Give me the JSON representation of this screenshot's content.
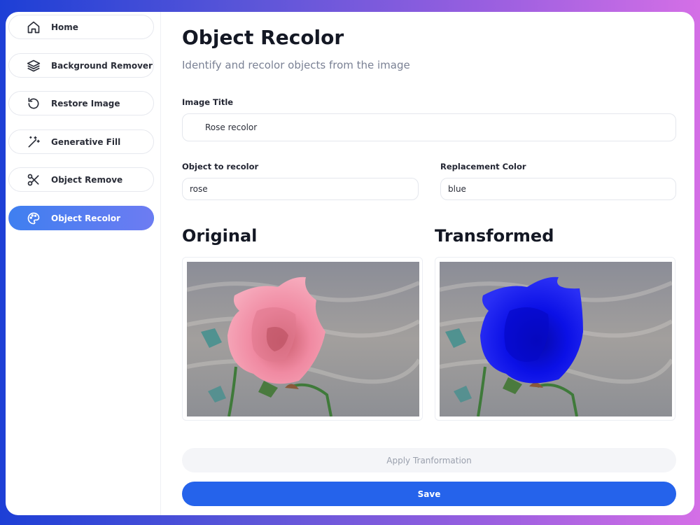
{
  "sidebar": {
    "items": [
      {
        "label": "Home",
        "icon": "home-icon",
        "active": false
      },
      {
        "label": "Background Remover",
        "icon": "layers-icon",
        "active": false
      },
      {
        "label": "Restore Image",
        "icon": "restore-icon",
        "active": false
      },
      {
        "label": "Generative Fill",
        "icon": "magic-wand-icon",
        "active": false
      },
      {
        "label": "Object Remove",
        "icon": "scissors-icon",
        "active": false
      },
      {
        "label": "Object Recolor",
        "icon": "palette-icon",
        "active": true
      }
    ]
  },
  "main": {
    "title": "Object Recolor",
    "subtitle": "Identify and recolor objects from the image",
    "image_title_label": "Image Title",
    "image_title_value": "Rose recolor",
    "object_label": "Object to recolor",
    "object_value": "rose",
    "color_label": "Replacement Color",
    "color_value": "blue",
    "original_heading": "Original",
    "transformed_heading": "Transformed",
    "apply_label": "Apply Tranformation",
    "save_label": "Save"
  },
  "colors": {
    "accent": "#2563eb",
    "active_nav_start": "#3f7ff0",
    "active_nav_end": "#6d7cf2",
    "rose_original": "#f08aa2",
    "rose_transformed": "#0b10e6"
  }
}
